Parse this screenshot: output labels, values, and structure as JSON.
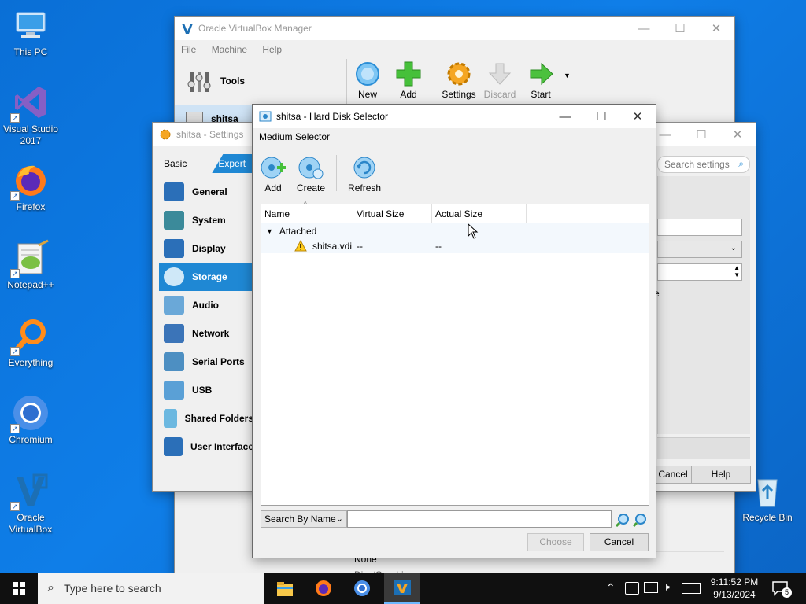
{
  "desktop": {
    "icons": [
      {
        "label": "This PC",
        "icon": "computer-icon"
      },
      {
        "label": "Visual Studio 2017",
        "icon": "visual-studio-icon"
      },
      {
        "label": "Firefox",
        "icon": "firefox-icon"
      },
      {
        "label": "Notepad++",
        "icon": "notepad-plus-plus-icon"
      },
      {
        "label": "Everything",
        "icon": "everything-search-icon"
      },
      {
        "label": "Chromium",
        "icon": "chromium-icon"
      },
      {
        "label": "Oracle VirtualBox",
        "icon": "virtualbox-icon"
      },
      {
        "label": "Recycle Bin",
        "icon": "recycle-bin-icon"
      }
    ]
  },
  "manager": {
    "title": "Oracle VirtualBox Manager",
    "menu": [
      "File",
      "Machine",
      "Help"
    ],
    "tools_label": "Tools",
    "vm_name": "shitsa",
    "toolbar": [
      "New",
      "Add",
      "Settings",
      "Discard",
      "Start"
    ],
    "bottom_text_1": "None",
    "bottom_text_2": "Disc/Graphics"
  },
  "settings": {
    "title": "shitsa - Settings",
    "tabs": [
      "Basic",
      "Expert"
    ],
    "search_placeholder": "Search settings",
    "nav": [
      "General",
      "System",
      "Display",
      "Storage",
      "Audio",
      "Network",
      "Serial Ports",
      "USB",
      "Shared Folders",
      "User Interface"
    ],
    "selected_nav": "Storage",
    "cancel_label": "Cancel",
    "help_label": "Help",
    "peek_text": "e"
  },
  "dialog": {
    "title": "shitsa - Hard Disk Selector",
    "section": "Medium Selector",
    "toolbar": [
      "Add",
      "Create",
      "Refresh"
    ],
    "columns": [
      "Name",
      "Virtual Size",
      "Actual Size"
    ],
    "group": "Attached",
    "rows": [
      {
        "name": "shitsa.vdi",
        "virtual_size": "--",
        "actual_size": "--"
      }
    ],
    "search_mode": "Search By Name",
    "search_value": "",
    "choose_label": "Choose",
    "cancel_label": "Cancel"
  },
  "taskbar": {
    "search_placeholder": "Type here to search",
    "time": "9:11:52 PM",
    "date": "9/13/2024",
    "notification_count": "5"
  },
  "colors": {
    "accent": "#1f88d4",
    "desktop": "#0b72d8",
    "taskbar": "#101010"
  }
}
